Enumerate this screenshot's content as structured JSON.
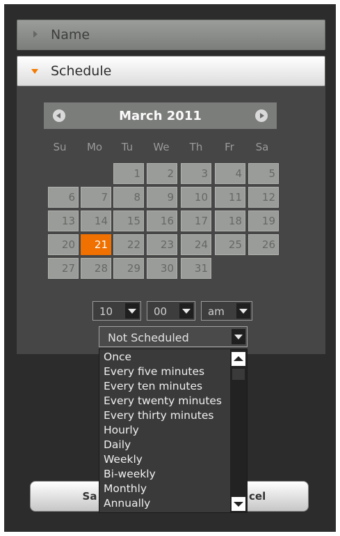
{
  "panels": {
    "name_label": "Name",
    "schedule_label": "Schedule"
  },
  "calendar": {
    "title": "March 2011",
    "weekdays": [
      "Su",
      "Mo",
      "Tu",
      "We",
      "Th",
      "Fr",
      "Sa"
    ],
    "days": [
      "1",
      "2",
      "3",
      "4",
      "5",
      "6",
      "7",
      "8",
      "9",
      "10",
      "11",
      "12",
      "13",
      "14",
      "15",
      "16",
      "17",
      "18",
      "19",
      "20",
      "21",
      "22",
      "23",
      "24",
      "25",
      "26",
      "27",
      "28",
      "29",
      "30",
      "31"
    ],
    "selected_day": "21"
  },
  "time": {
    "hour": "10",
    "minute": "00",
    "ampm": "am"
  },
  "recurrence": {
    "selected": "Not Scheduled",
    "options": [
      "Once",
      "Every five minutes",
      "Every ten minutes",
      "Every twenty minutes",
      "Every thirty minutes",
      "Hourly",
      "Daily",
      "Weekly",
      "Bi-weekly",
      "Monthly",
      "Annually"
    ]
  },
  "buttons": {
    "save_visible": "Sa",
    "cancel_visible": "cel"
  },
  "colors": {
    "accent": "#f07000",
    "panel_bg": "#464646",
    "frame_bg": "#2b2c2b"
  },
  "icons": {
    "collapsed": "triangle-right-icon",
    "expanded": "triangle-down-icon",
    "prev": "circle-left-arrow-icon",
    "next": "circle-right-arrow-icon",
    "dropdown": "caret-down-icon"
  }
}
